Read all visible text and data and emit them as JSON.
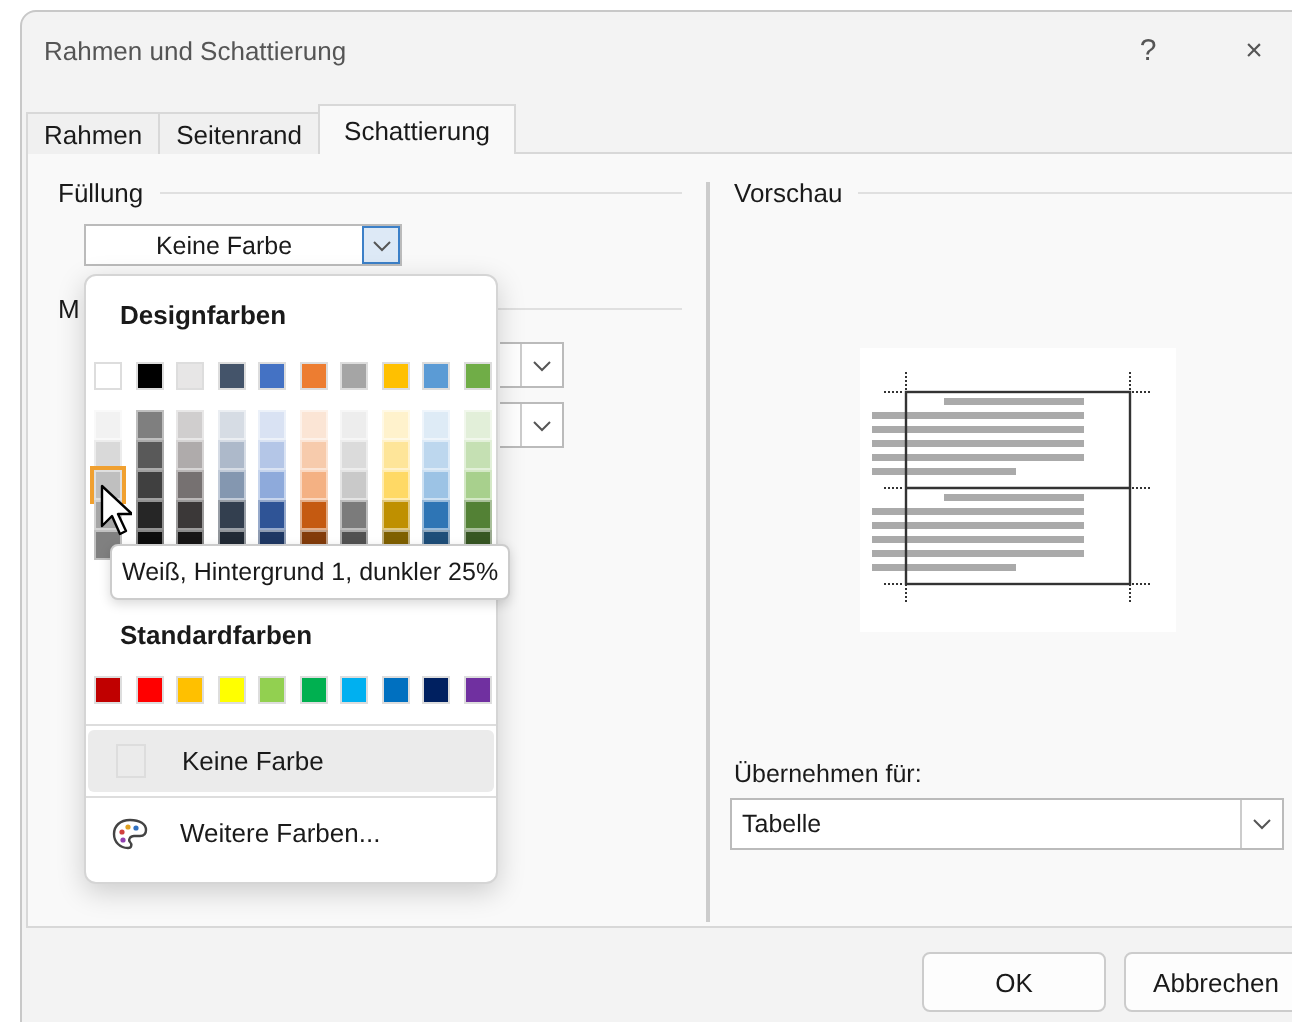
{
  "window": {
    "title": "Rahmen und Schattierung",
    "help": "?",
    "close": "×"
  },
  "tabs": [
    {
      "label": "Rahmen",
      "selected": false
    },
    {
      "label": "Seitenrand",
      "selected": false
    },
    {
      "label": "Schattierung",
      "selected": true
    }
  ],
  "fill": {
    "label": "Füllung",
    "value": "Keine Farbe"
  },
  "pattern": {
    "label": "M"
  },
  "color_menu": {
    "theme_heading": "Designfarben",
    "theme_colors": [
      {
        "color": "#ffffff",
        "selected": false,
        "shades": [
          {
            "color": "#f2f2f2",
            "selected": false
          },
          {
            "color": "#d9d9d9",
            "selected": false
          },
          {
            "color": "#bfbfbf",
            "selected": true
          },
          {
            "color": "#a6a6a6",
            "selected": false
          },
          {
            "color": "#808080",
            "selected": false
          }
        ]
      },
      {
        "color": "#000000",
        "selected": false,
        "shades": [
          {
            "color": "#7f7f7f",
            "selected": false
          },
          {
            "color": "#595959",
            "selected": false
          },
          {
            "color": "#404040",
            "selected": false
          },
          {
            "color": "#262626",
            "selected": false
          },
          {
            "color": "#0d0d0d",
            "selected": false
          }
        ]
      },
      {
        "color": "#e7e6e6",
        "selected": false,
        "shades": [
          {
            "color": "#d0cece",
            "selected": false
          },
          {
            "color": "#afabab",
            "selected": false
          },
          {
            "color": "#767171",
            "selected": false
          },
          {
            "color": "#3b3838",
            "selected": false
          },
          {
            "color": "#171616",
            "selected": false
          }
        ]
      },
      {
        "color": "#44546a",
        "selected": false,
        "shades": [
          {
            "color": "#d6dce4",
            "selected": false
          },
          {
            "color": "#adb9ca",
            "selected": false
          },
          {
            "color": "#8497b0",
            "selected": false
          },
          {
            "color": "#333f4f",
            "selected": false
          },
          {
            "color": "#222a35",
            "selected": false
          }
        ]
      },
      {
        "color": "#4472c4",
        "selected": false,
        "shades": [
          {
            "color": "#d9e2f3",
            "selected": false
          },
          {
            "color": "#b4c6e7",
            "selected": false
          },
          {
            "color": "#8eaadb",
            "selected": false
          },
          {
            "color": "#2f5496",
            "selected": false
          },
          {
            "color": "#1f3864",
            "selected": false
          }
        ]
      },
      {
        "color": "#ed7d31",
        "selected": false,
        "shades": [
          {
            "color": "#fbe5d5",
            "selected": false
          },
          {
            "color": "#f7cbac",
            "selected": false
          },
          {
            "color": "#f4b183",
            "selected": false
          },
          {
            "color": "#c55a11",
            "selected": false
          },
          {
            "color": "#833c0b",
            "selected": false
          }
        ]
      },
      {
        "color": "#a5a5a5",
        "selected": false,
        "shades": [
          {
            "color": "#ededed",
            "selected": false
          },
          {
            "color": "#dbdbdb",
            "selected": false
          },
          {
            "color": "#c9c9c9",
            "selected": false
          },
          {
            "color": "#7b7b7b",
            "selected": false
          },
          {
            "color": "#525252",
            "selected": false
          }
        ]
      },
      {
        "color": "#ffc000",
        "selected": false,
        "shades": [
          {
            "color": "#fff2cc",
            "selected": false
          },
          {
            "color": "#fee599",
            "selected": false
          },
          {
            "color": "#ffd965",
            "selected": false
          },
          {
            "color": "#bf9000",
            "selected": false
          },
          {
            "color": "#7f6000",
            "selected": false
          }
        ]
      },
      {
        "color": "#5b9bd5",
        "selected": false,
        "shades": [
          {
            "color": "#deebf6",
            "selected": false
          },
          {
            "color": "#bdd7ee",
            "selected": false
          },
          {
            "color": "#9cc3e5",
            "selected": false
          },
          {
            "color": "#2e75b5",
            "selected": false
          },
          {
            "color": "#1e4e79",
            "selected": false
          }
        ]
      },
      {
        "color": "#70ad47",
        "selected": false,
        "shades": [
          {
            "color": "#e2efd9",
            "selected": false
          },
          {
            "color": "#c5e0b3",
            "selected": false
          },
          {
            "color": "#a8d08d",
            "selected": false
          },
          {
            "color": "#538135",
            "selected": false
          },
          {
            "color": "#375623",
            "selected": false
          }
        ]
      }
    ],
    "standard_heading": "Standardfarben",
    "standard_colors": [
      {
        "color": "#c00000",
        "selected": false
      },
      {
        "color": "#ff0000",
        "selected": false
      },
      {
        "color": "#ffc000",
        "selected": false
      },
      {
        "color": "#ffff00",
        "selected": false
      },
      {
        "color": "#92d050",
        "selected": false
      },
      {
        "color": "#00b050",
        "selected": false
      },
      {
        "color": "#00b0f0",
        "selected": false
      },
      {
        "color": "#0070c0",
        "selected": false
      },
      {
        "color": "#002060",
        "selected": false
      },
      {
        "color": "#7030a0",
        "selected": false
      }
    ],
    "no_color": {
      "label": "Keine Farbe",
      "hovered": true
    },
    "more_colors": {
      "label": "Weitere Farben..."
    }
  },
  "tooltip": "Weiß, Hintergrund 1, dunkler 25%",
  "preview": {
    "label": "Vorschau"
  },
  "apply_to": {
    "label": "Übernehmen für:",
    "value": "Tabelle"
  },
  "buttons": [
    {
      "label": "OK"
    },
    {
      "label": "Abbrechen"
    }
  ]
}
